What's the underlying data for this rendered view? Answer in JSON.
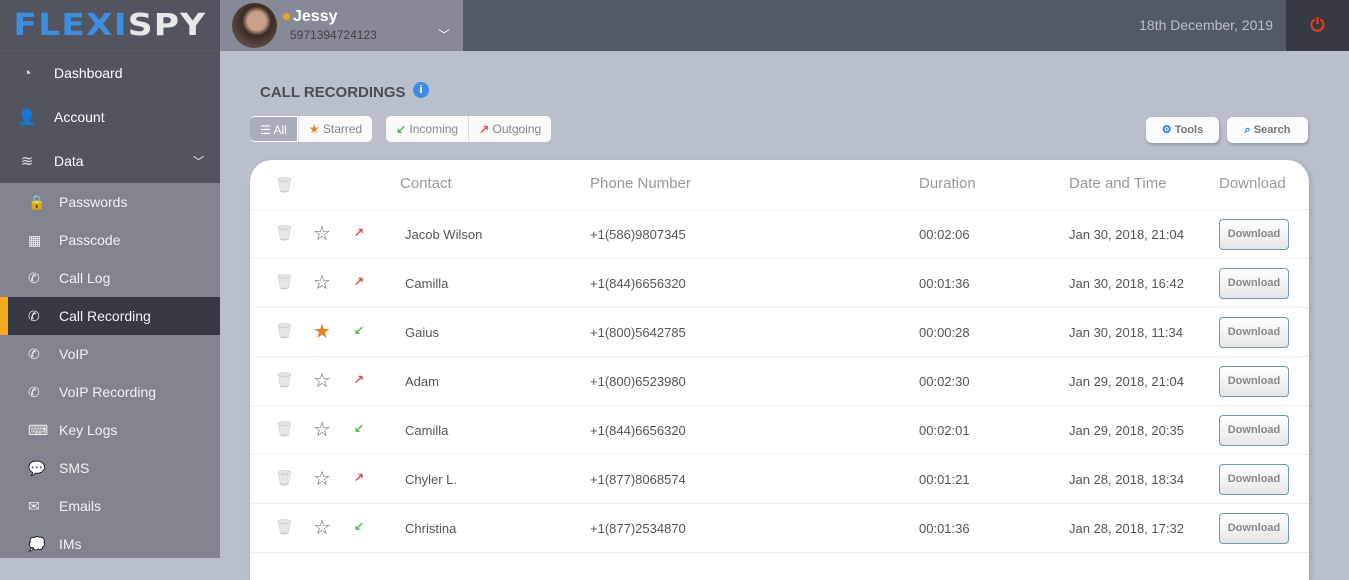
{
  "logo": {
    "part1": "FLEXI",
    "part2": "SPY"
  },
  "user": {
    "name": "Jessy",
    "id": "5971394724123"
  },
  "header": {
    "date": "18th December, 2019"
  },
  "sidebar": {
    "items": [
      {
        "label": "Dashboard",
        "icon": "◔"
      },
      {
        "label": "Account",
        "icon": "👤"
      },
      {
        "label": "Data",
        "icon": "≋"
      }
    ],
    "sub": [
      {
        "label": "Passwords",
        "icon": "🔒"
      },
      {
        "label": "Passcode",
        "icon": "▦"
      },
      {
        "label": "Call Log",
        "icon": "✆"
      },
      {
        "label": "Call Recording",
        "icon": "✆"
      },
      {
        "label": "VoIP",
        "icon": "✆"
      },
      {
        "label": "VoIP Recording",
        "icon": "✆"
      },
      {
        "label": "Key Logs",
        "icon": "⌨"
      },
      {
        "label": "SMS",
        "icon": "💬"
      },
      {
        "label": "Emails",
        "icon": "✉"
      },
      {
        "label": "IMs",
        "icon": "💭"
      }
    ]
  },
  "page": {
    "title": "CALL RECORDINGS"
  },
  "filters": {
    "all": "All",
    "starred": "Starred",
    "incoming": "Incoming",
    "outgoing": "Outgoing"
  },
  "tools": {
    "tools": "Tools",
    "search": "Search"
  },
  "table": {
    "headers": {
      "contact": "Contact",
      "phone": "Phone Number",
      "duration": "Duration",
      "datetime": "Date and Time",
      "download": "Download"
    },
    "rows": [
      {
        "starred": false,
        "direction": "outgoing",
        "contact": "Jacob Wilson",
        "phone": "+1(586)9807345",
        "duration": "00:02:06",
        "datetime": "Jan 30, 2018, 21:04",
        "download": "Download"
      },
      {
        "starred": false,
        "direction": "outgoing",
        "contact": "Camilla",
        "phone": "+1(844)6656320",
        "duration": "00:01:36",
        "datetime": "Jan 30, 2018, 16:42",
        "download": "Download"
      },
      {
        "starred": true,
        "direction": "incoming",
        "contact": "Gaius",
        "phone": "+1(800)5642785",
        "duration": "00:00:28",
        "datetime": "Jan 30, 2018, 11:34",
        "download": "Download"
      },
      {
        "starred": false,
        "direction": "outgoing",
        "contact": "Adam",
        "phone": "+1(800)6523980",
        "duration": "00:02:30",
        "datetime": "Jan 29, 2018, 21:04",
        "download": "Download"
      },
      {
        "starred": false,
        "direction": "incoming",
        "contact": "Camilla",
        "phone": "+1(844)6656320",
        "duration": "00:02:01",
        "datetime": "Jan 29, 2018, 20:35",
        "download": "Download"
      },
      {
        "starred": false,
        "direction": "outgoing",
        "contact": "Chyler L.",
        "phone": "+1(877)8068574",
        "duration": "00:01:21",
        "datetime": "Jan 28, 2018, 18:34",
        "download": "Download"
      },
      {
        "starred": false,
        "direction": "incoming",
        "contact": "Christina",
        "phone": "+1(877)2534870",
        "duration": "00:01:36",
        "datetime": "Jan 28, 2018, 17:32",
        "download": "Download"
      }
    ]
  },
  "colors": {
    "incoming": "#5cb85c",
    "outgoing": "#e05050",
    "accent": "#f5a623"
  }
}
